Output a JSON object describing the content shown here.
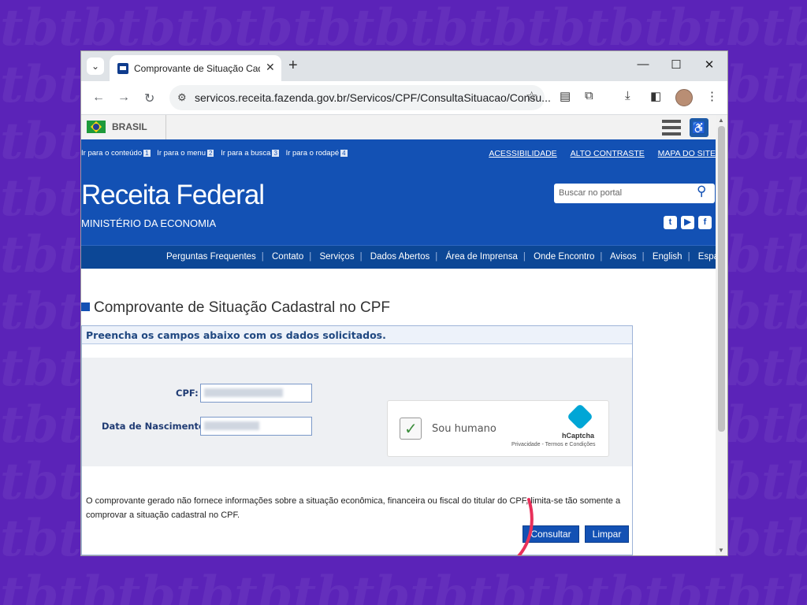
{
  "browser": {
    "tab_title": "Comprovante de Situação Cada",
    "url": "servicos.receita.fazenda.gov.br/Servicos/CPF/ConsultaSituacao/Consu..."
  },
  "govbar": {
    "country": "BRASIL"
  },
  "header": {
    "skip_links": [
      {
        "label": "Ir para o conteúdo",
        "key": "1"
      },
      {
        "label": "Ir para o menu",
        "key": "2"
      },
      {
        "label": "Ir para a busca",
        "key": "3"
      },
      {
        "label": "Ir para o rodapé",
        "key": "4"
      }
    ],
    "top_links": [
      "ACESSIBILIDADE",
      "ALTO CONTRASTE",
      "MAPA DO SITE"
    ],
    "title": "Receita Federal",
    "subtitle": "MINISTÉRIO DA ECONOMIA",
    "search_placeholder": "Buscar no portal"
  },
  "menu": [
    "Perguntas Frequentes",
    "Contato",
    "Serviços",
    "Dados Abertos",
    "Área de Imprensa",
    "Onde Encontro",
    "Avisos",
    "English",
    "Español"
  ],
  "page": {
    "title": "Comprovante de Situação Cadastral no CPF",
    "form_header": "Preencha os campos abaixo com os dados solicitados.",
    "cpf_label": "CPF:",
    "cpf_value": "***.***.***-**",
    "birth_label": "Data de Nascimento:",
    "birth_value": "**/**/****",
    "captcha_label": "Sou humano",
    "captcha_brand": "hCaptcha",
    "captcha_links": "Privacidade - Termos e Condições",
    "notice": "O comprovante gerado não fornece informações sobre a situação econômica, financeira ou fiscal do titular do CPF, limita-se tão somente a comprovar a situação cadastral no CPF.",
    "submit_label": "Consultar",
    "clear_label": "Limpar"
  },
  "colors": {
    "brand_blue": "#1351b4",
    "background": "#5b23b8",
    "annotation_arrow": "#e8305a"
  }
}
